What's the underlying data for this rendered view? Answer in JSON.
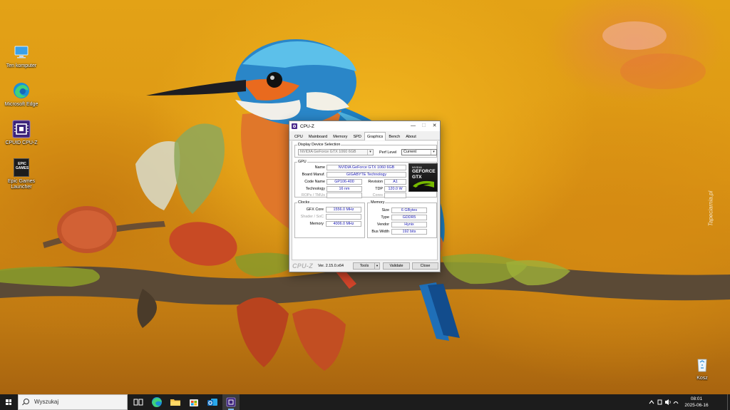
{
  "desktop": {
    "icons": [
      {
        "label": "Ten komputer",
        "icon": "computer-icon"
      },
      {
        "label": "Microsoft Edge",
        "icon": "edge-icon"
      },
      {
        "label": "CPUID CPU-Z",
        "icon": "cpuz-icon"
      },
      {
        "label": "Epic Games Launcher",
        "icon": "epic-games-icon",
        "badge_text": "EPIC GAMES"
      },
      {
        "label": "Kosz",
        "icon": "recycle-bin-icon"
      }
    ],
    "watermark": "Tapeciarnia.pl"
  },
  "window": {
    "title": "CPU-Z",
    "controls": {
      "minimize": "—",
      "maximize": "☐",
      "close": "✕"
    },
    "tabs": [
      {
        "label": "CPU",
        "active": false
      },
      {
        "label": "Mainboard",
        "active": false
      },
      {
        "label": "Memory",
        "active": false
      },
      {
        "label": "SPD",
        "active": false
      },
      {
        "label": "Graphics",
        "active": true
      },
      {
        "label": "Bench",
        "active": false
      },
      {
        "label": "About",
        "active": false
      }
    ],
    "display_selection": {
      "title": "Display Device Selection",
      "device": "NVIDIA GeForce GTX 1060 6GB",
      "perf_level_label": "Perf Level",
      "perf_level_value": "Current"
    },
    "gpu": {
      "title": "GPU",
      "name_label": "Name",
      "name": "NVIDIA GeForce GTX 1060 6GB",
      "board_label": "Board Manuf.",
      "board": "GIGABYTE Technology",
      "code_label": "Code Name",
      "code": "GP106-400",
      "revision_label": "Revision",
      "revision": "A1",
      "tech_label": "Technology",
      "tech": "16 nm",
      "tdp_label": "TDP",
      "tdp": "120.0 W",
      "rops_label": "ROPs / TMUs",
      "cores_label": "Cores",
      "logo": {
        "line1": "NVIDIA",
        "line2": "GEFORCE",
        "line3": "GTX"
      }
    },
    "clocks": {
      "title": "Clocks",
      "gfx_label": "GFX Core",
      "gfx": "1556.0 MHz",
      "shader_label": "Shader / SoC",
      "memory_label": "Memory",
      "memory": "4006.0 MHz"
    },
    "memory": {
      "title": "Memory",
      "size_label": "Size",
      "size": "6 GBytes",
      "type_label": "Type",
      "type": "GDDR5",
      "vendor_label": "Vendor",
      "vendor": "Hynix",
      "bus_label": "Bus Width",
      "bus": "192 bits"
    },
    "footer": {
      "brand": "CPU-Z",
      "version": "Ver. 2.15.0.x64",
      "tools": "Tools",
      "validate": "Validate",
      "close": "Close"
    }
  },
  "taskbar": {
    "search_placeholder": "Wyszukaj",
    "apps": [
      "task-view-icon",
      "edge-icon",
      "file-explorer-icon",
      "microsoft-store-icon",
      "outlook-icon",
      "cpuz-icon"
    ],
    "clock": {
      "time": "08:01",
      "date": "2025-06-16"
    }
  }
}
